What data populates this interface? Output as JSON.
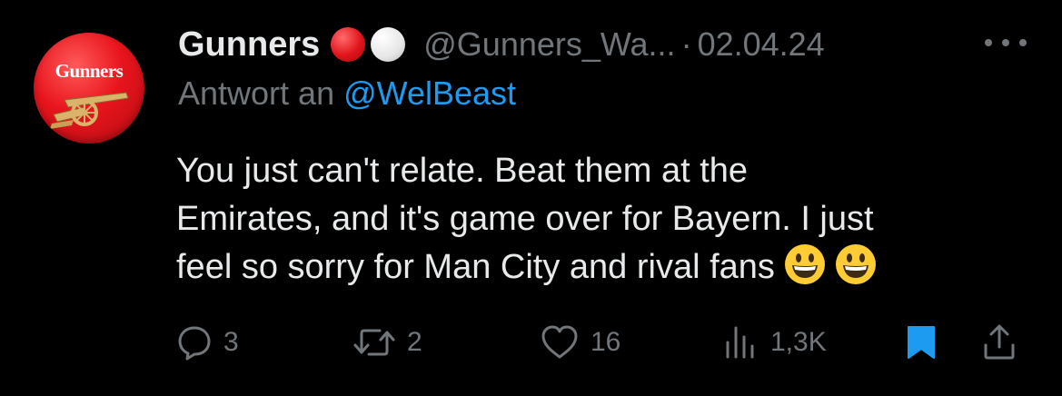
{
  "author": {
    "display_name": "Gunners",
    "flag_emoji": [
      "red-circle",
      "white-circle"
    ],
    "handle": "@Gunners_Wa...",
    "separator": "·",
    "date": "02.04.24",
    "avatar_text": "Gunners"
  },
  "reply": {
    "prefix": "Antwort an",
    "mention": "@WelBeast"
  },
  "tweet": {
    "lines": [
      "You just can't relate. Beat them at the",
      "Emirates, and it's game over for Bayern. I just",
      "feel so sorry for Man City and rival fans"
    ],
    "trailing_emoji": [
      "grinning-face",
      "grinning-face"
    ]
  },
  "actions": {
    "reply_count": "3",
    "retweet_count": "2",
    "like_count": "16",
    "views_count": "1,3K"
  },
  "icons": {
    "more": "more-icon",
    "reply": "reply-icon",
    "retweet": "retweet-icon",
    "like": "heart-icon",
    "views": "views-icon",
    "bookmark": "bookmark-icon",
    "share": "share-icon"
  },
  "colors": {
    "background": "#000000",
    "text_primary": "#e7e9ea",
    "text_secondary": "#71767b",
    "accent": "#1d9bf0",
    "bookmark_active": "#1d9bf0"
  }
}
